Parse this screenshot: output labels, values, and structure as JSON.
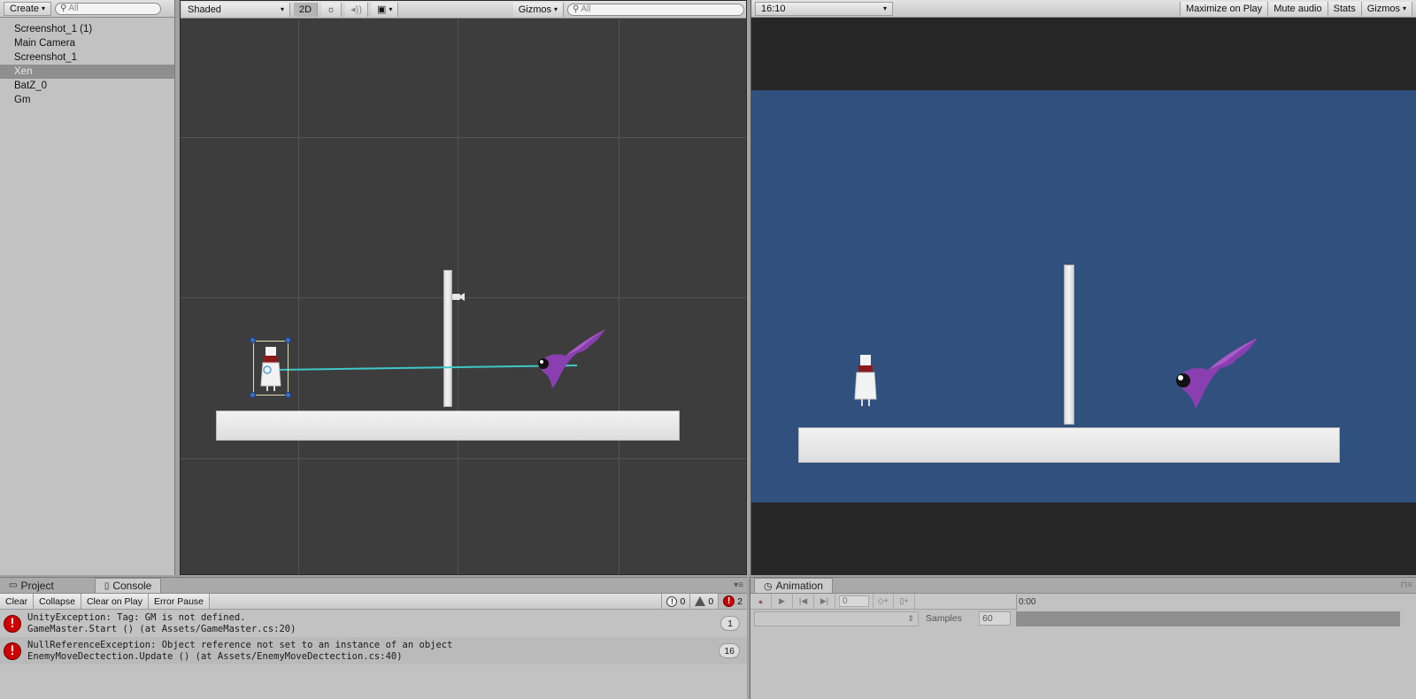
{
  "hierarchy": {
    "create_label": "Create",
    "search_placeholder": "All",
    "items": [
      {
        "label": "Screenshot_1 (1)"
      },
      {
        "label": "Main Camera"
      },
      {
        "label": "Screenshot_1"
      },
      {
        "label": "Xen",
        "selected": true
      },
      {
        "label": "BatZ_0"
      },
      {
        "label": "Gm"
      }
    ]
  },
  "scene": {
    "shading_mode": "Shaded",
    "mode_2d_label": "2D",
    "gizmos_label": "Gizmos",
    "search_placeholder": "All"
  },
  "game": {
    "aspect": "16:10",
    "maximize_label": "Maximize on Play",
    "mute_label": "Mute audio",
    "stats_label": "Stats",
    "gizmos_label": "Gizmos",
    "sky_color": "#30507e"
  },
  "console": {
    "tabs": {
      "project": "Project",
      "console": "Console"
    },
    "toolbar": {
      "clear": "Clear",
      "collapse": "Collapse",
      "clear_on_play": "Clear on Play",
      "error_pause": "Error Pause"
    },
    "counts": {
      "info": "0",
      "warnings": "0",
      "errors": "2"
    },
    "logs": [
      {
        "line1": "UnityException: Tag: GM is not defined.",
        "line2": "GameMaster.Start () (at Assets/GameMaster.cs:20)",
        "count": "1"
      },
      {
        "line1": "NullReferenceException: Object reference not set to an instance of an object",
        "line2": "EnemyMoveDectection.Update () (at Assets/EnemyMoveDectection.cs:40)",
        "count": "16"
      }
    ]
  },
  "animation": {
    "tab_label": "Animation",
    "frame_value": "0",
    "time_label": "0:00",
    "samples_label": "Samples",
    "samples_value": "60"
  }
}
